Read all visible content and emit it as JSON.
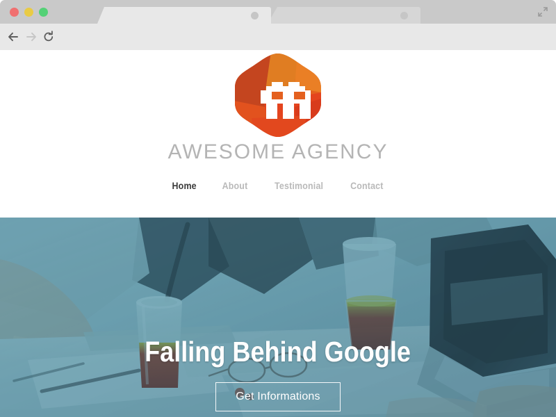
{
  "browser": {
    "window_controls": [
      {
        "name": "close",
        "color": "#f07070"
      },
      {
        "name": "minimize",
        "color": "#e9cb45"
      },
      {
        "name": "maximize",
        "color": "#54d176"
      }
    ],
    "tabs": [
      {
        "title": "",
        "active": true
      },
      {
        "title": "",
        "active": false
      }
    ],
    "toolbar": {
      "back_icon": "back-arrow-icon",
      "forward_icon": "forward-arrow-icon",
      "reload_icon": "reload-icon",
      "bookmark_icon": "star-icon",
      "menu_icon": "hamburger-menu-icon",
      "fullscreen_icon": "fullscreen-expand-icon"
    },
    "address_bar": {
      "value": "",
      "placeholder": ""
    }
  },
  "site": {
    "logo": {
      "icon": "hexagon-double-a-logo",
      "colors": {
        "dark_orange": "#c3451f",
        "mid_orange": "#e07d22",
        "bright_orange": "#e8601f",
        "red_orange": "#e4441e",
        "deep_red": "#d33a1c"
      }
    },
    "brand_name": "AWESOME AGENCY",
    "nav": [
      {
        "label": "Home",
        "active": true
      },
      {
        "label": "About",
        "active": false
      },
      {
        "label": "Testimonial",
        "active": false
      },
      {
        "label": "Contact",
        "active": false
      }
    ],
    "hero": {
      "title": "Falling Behind Google",
      "cta_label": "Get Informations",
      "overlay_color": "#4d8ca6"
    }
  }
}
